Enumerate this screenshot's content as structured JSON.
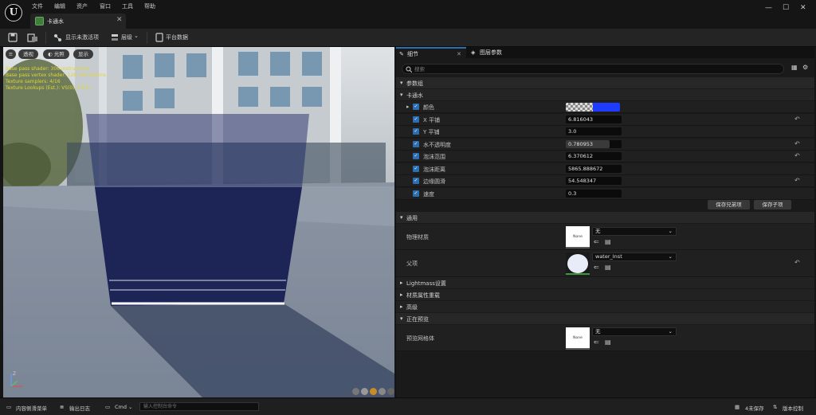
{
  "menu": [
    "文件",
    "编辑",
    "资产",
    "窗口",
    "工具",
    "帮助"
  ],
  "tab": {
    "title": "卡通水"
  },
  "toolbar": {
    "show_inactive": "显示未激活项",
    "hierarchy": "层级",
    "platform_data": "平台数据"
  },
  "viewport": {
    "perspective": "透视",
    "lit": "光照",
    "show": "显示",
    "info": [
      "Base pass shader: 306 instructions",
      "Base pass vertex shader: 128 instructions",
      "Texture samplers: 4/16",
      "Texture Lookups (Est.): VS(0), PS(5)"
    ]
  },
  "details": {
    "tab_label": "细节",
    "layer_tab": "图层参数",
    "search_placeholder": "搜索"
  },
  "sections": {
    "param_group": "参数组",
    "toon_water": "卡通水",
    "general": "通用",
    "lightmass": "Lightmass设置",
    "material_override": "材质属性重载",
    "advanced": "高级",
    "preview": "正在预览"
  },
  "params": [
    {
      "label": "颜色",
      "value": "",
      "color": "#1e3cff"
    },
    {
      "label": "X 平铺",
      "value": "6.816043",
      "reset": true
    },
    {
      "label": "Y 平铺",
      "value": "3.0",
      "reset": false
    },
    {
      "label": "水不透明度",
      "value": "0.780953",
      "reset": true,
      "fill": 0.781
    },
    {
      "label": "泡沫范围",
      "value": "6.370612",
      "reset": true
    },
    {
      "label": "泡沫距离",
      "value": "5865.888672",
      "reset": false
    },
    {
      "label": "边缘圆滑",
      "value": "54.548347",
      "reset": true
    },
    {
      "label": "速度",
      "value": "0.3",
      "reset": false
    }
  ],
  "buttons": {
    "save_siblings": "保存兄弟项",
    "save_children": "保存子项"
  },
  "general": {
    "phys_label": "物理材质",
    "phys_value": "无",
    "phys_thumb": "None",
    "parent_label": "父项",
    "parent_value": "water_Inst"
  },
  "preview": {
    "mesh_label": "预览网格体",
    "mesh_value": "无",
    "mesh_thumb": "None"
  },
  "status": {
    "content_drawer": "内容侧滑菜单",
    "output_log": "输出日志",
    "cmd": "Cmd",
    "cmd_placeholder": "输入控制台命令",
    "unsaved": "4未保存",
    "source_control": "版本控制"
  },
  "colors": {
    "accent": "#2c6fae",
    "water": "#1d2456",
    "background": "#151515"
  }
}
